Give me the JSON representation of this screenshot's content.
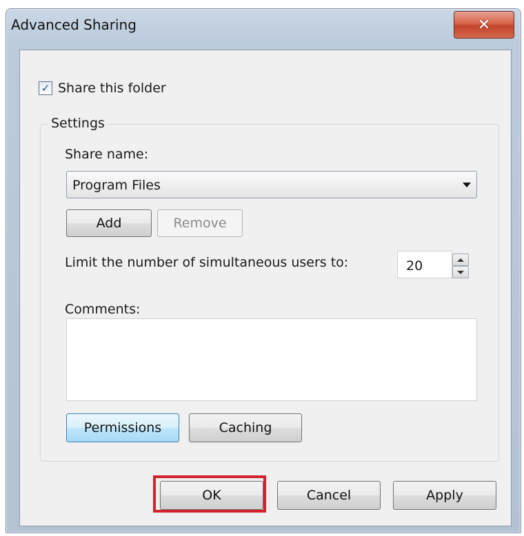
{
  "window": {
    "title": "Advanced Sharing",
    "close_glyph": "✕"
  },
  "share": {
    "checkbox_label": "Share this folder",
    "checked": true,
    "check_glyph": "✓"
  },
  "settings": {
    "legend": "Settings",
    "share_name_label": "Share name:",
    "share_name_value": "Program Files",
    "add_label": "Add",
    "remove_label": "Remove",
    "limit_label": "Limit the number of simultaneous users to:",
    "limit_value": "20",
    "comments_label": "Comments:",
    "comments_value": "",
    "permissions_label": "Permissions",
    "caching_label": "Caching"
  },
  "footer": {
    "ok_label": "OK",
    "cancel_label": "Cancel",
    "apply_label": "Apply"
  },
  "colors": {
    "highlight": "#d0232d",
    "close_button": "#c2432a"
  }
}
